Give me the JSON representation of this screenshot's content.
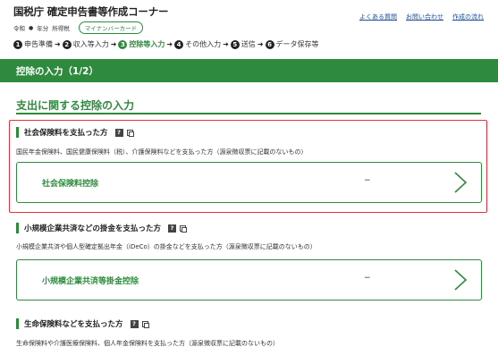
{
  "header": {
    "title": "国税庁 確定申告書等作成コーナー",
    "year": "令和",
    "year_icon": "circle-bullet",
    "year_suffix": "年分",
    "tax_type": "所得税",
    "mynumber_badge": "マイナンバーカード",
    "links": [
      "よくある質問",
      "お問い合わせ",
      "作成の流れ"
    ]
  },
  "steps": [
    {
      "num": "1",
      "label": "申告準備"
    },
    {
      "num": "2",
      "label": "収入等入力"
    },
    {
      "num": "3",
      "label": "控除等入力",
      "active": true
    },
    {
      "num": "4",
      "label": "その他入力"
    },
    {
      "num": "5",
      "label": "送信"
    },
    {
      "num": "6",
      "label": "データ保存等"
    }
  ],
  "page": {
    "bar_title": "控除の入力（1/2）",
    "section_title": "支出に関する控除の入力"
  },
  "blocks": [
    {
      "title": "社会保険料を支払った方",
      "description": "国民年金保険料、国民健康保険料（税）、介護保険料などを支払った方（源泉徴収票に記載のないもの）",
      "card_label": "社会保険料控除",
      "card_value": "−"
    },
    {
      "title": "小規模企業共済などの掛金を支払った方",
      "description": "小規模企業共済や個人型確定拠出年金（iDeCo）の掛金などを支払った方（源泉徴収票に記載のないもの）",
      "card_label": "小規模企業共済等掛金控除",
      "card_value": "−"
    },
    {
      "title": "生命保険料などを支払った方",
      "description": "生命保険料や介護医療保険料、個人年金保険料を支払った方（源泉徴収票に記載のないもの）"
    }
  ],
  "icons": {
    "help": "?",
    "step_arrow": "➜"
  },
  "colors": {
    "brand_green": "#2e8b3e",
    "highlight_red": "#e0343a",
    "link_blue": "#1a4fa0"
  }
}
